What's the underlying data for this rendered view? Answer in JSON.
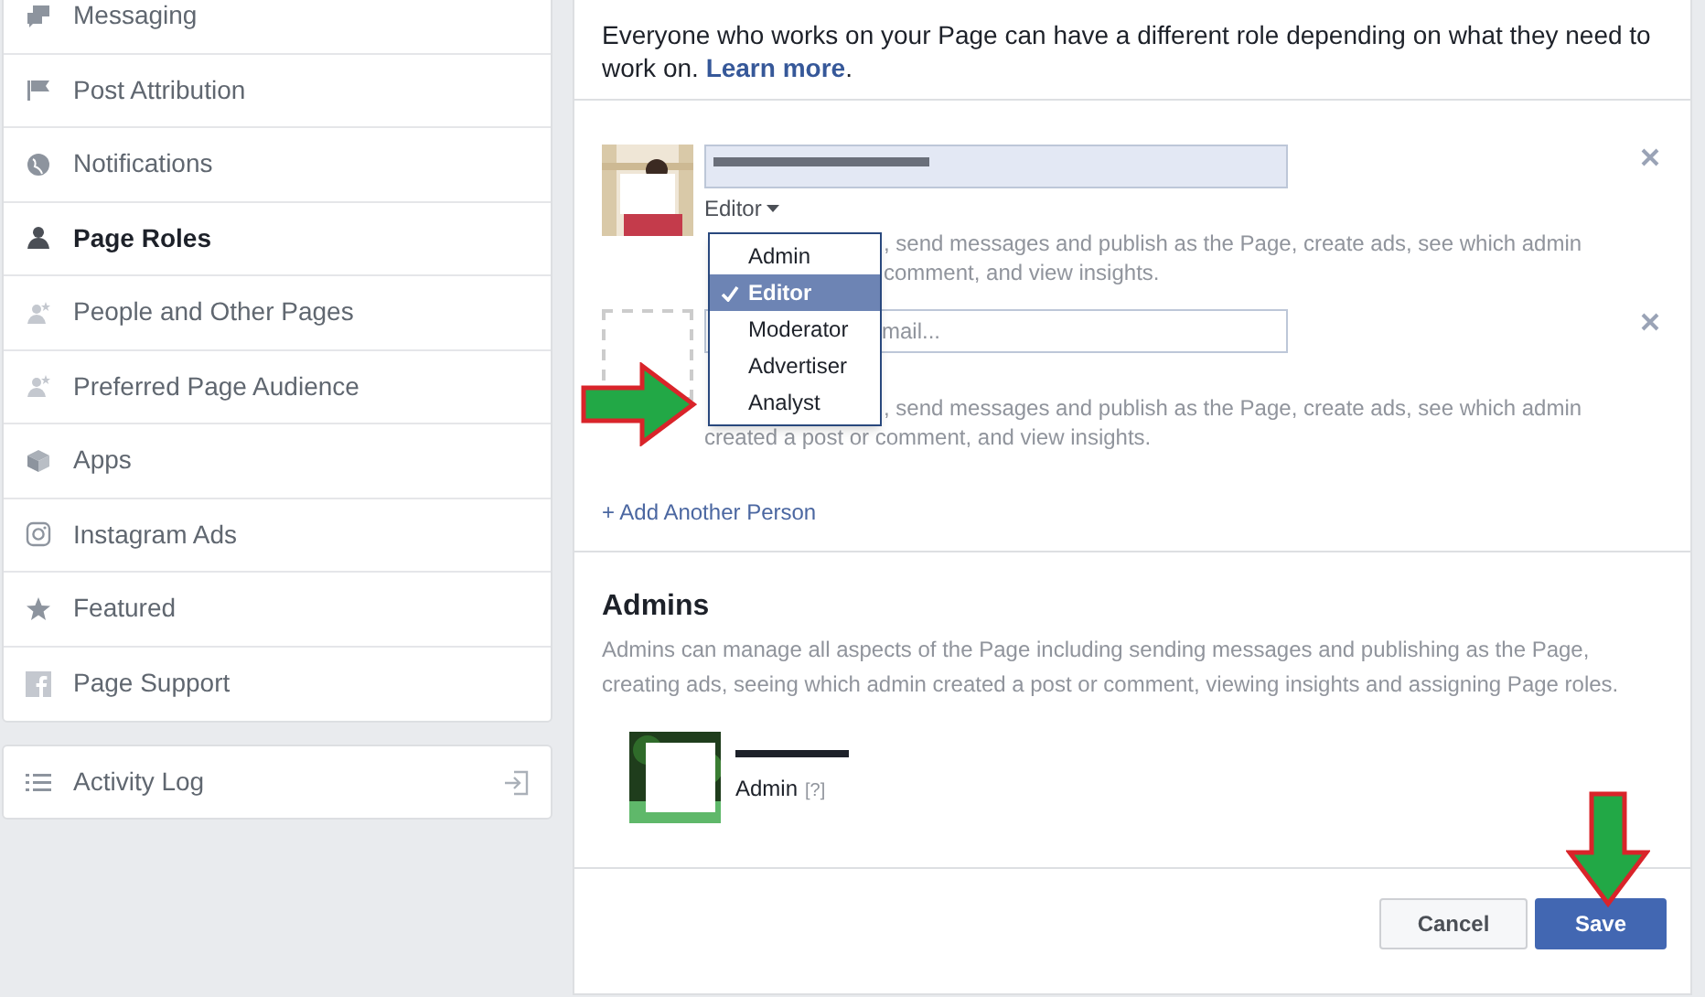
{
  "sidebar": {
    "items": [
      {
        "label": "Messaging",
        "selected": false
      },
      {
        "label": "Post Attribution",
        "selected": false
      },
      {
        "label": "Notifications",
        "selected": false
      },
      {
        "label": "Page Roles",
        "selected": true
      },
      {
        "label": "People and Other Pages",
        "selected": false
      },
      {
        "label": "Preferred Page Audience",
        "selected": false
      },
      {
        "label": "Apps",
        "selected": false
      },
      {
        "label": "Instagram Ads",
        "selected": false
      },
      {
        "label": "Featured",
        "selected": false
      },
      {
        "label": "Page Support",
        "selected": false
      }
    ],
    "activity_log": {
      "label": "Activity Log"
    }
  },
  "intro": {
    "text": "Everyone who works on your Page can have a different role depending on what they need to work on.",
    "link": "Learn more",
    "suffix": "."
  },
  "people": [
    {
      "kind": "filled",
      "role": "Editor",
      "description_lines": [
        ", send messages and publish as the Page, create ads, see which admin",
        "comment, and view insights."
      ]
    },
    {
      "kind": "empty",
      "placeholder": "mail...",
      "description_lines": [
        ", send messages and publish as the Page, create ads, see which admin",
        "created a post or comment, and view insights."
      ]
    }
  ],
  "role_menu": [
    {
      "label": "Admin",
      "selected": false
    },
    {
      "label": "Editor",
      "selected": true
    },
    {
      "label": "Moderator",
      "selected": false
    },
    {
      "label": "Advertiser",
      "selected": false
    },
    {
      "label": "Analyst",
      "selected": false
    }
  ],
  "add_person": "+ Add Another Person",
  "admins": {
    "title": "Admins",
    "description": "Admins can manage all aspects of the Page including sending messages and publishing as the Page, creating ads, seeing which admin created a post or comment, viewing insights and assigning Page roles.",
    "list": [
      {
        "role": "Admin",
        "help": "[?]"
      }
    ]
  },
  "buttons": {
    "cancel": "Cancel",
    "save": "Save"
  }
}
